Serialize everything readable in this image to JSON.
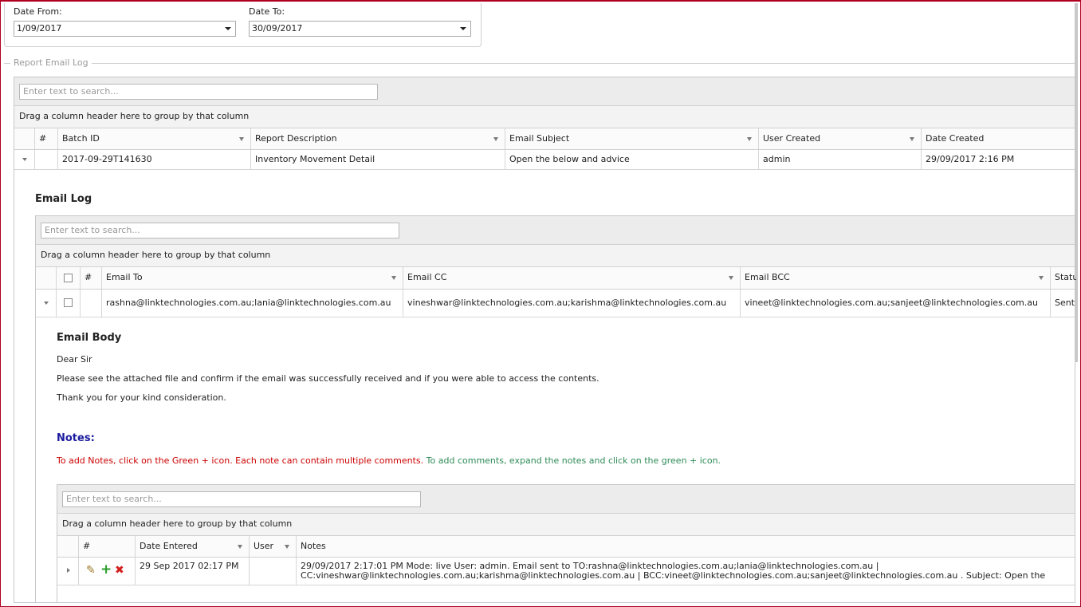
{
  "filters": {
    "date_from_label": "Date From:",
    "date_from_value": "1/09/2017",
    "date_to_label": "Date To:",
    "date_to_value": "30/09/2017"
  },
  "report_log": {
    "group_title": "Report Email Log",
    "search_placeholder": "Enter text to search...",
    "group_panel_text": "Drag a column header here to group by that column",
    "columns": {
      "row_number": "#",
      "batch_id": "Batch ID",
      "report_description": "Report Description",
      "email_subject": "Email Subject",
      "user_created": "User Created",
      "date_created": "Date Created"
    },
    "row": {
      "batch_id": "2017-09-29T141630",
      "report_description": "Inventory Movement Detail",
      "email_subject": "Open the below and advice",
      "user_created": "admin",
      "date_created": "29/09/2017 2:16 PM"
    }
  },
  "email_log": {
    "title": "Email Log",
    "search_placeholder": "Enter text to search...",
    "group_panel_text": "Drag a column header here to group by that column",
    "columns": {
      "row_number": "#",
      "email_to": "Email To",
      "email_cc": "Email CC",
      "email_bcc": "Email BCC",
      "status": "Statu"
    },
    "row": {
      "email_to": "rashna@linktechnologies.com.au;lania@linktechnologies.com.au",
      "email_cc": "vineshwar@linktechnologies.com.au;karishma@linktechnologies.com.au",
      "email_bcc": "vineet@linktechnologies.com.au;sanjeet@linktechnologies.com.au",
      "status": "Sent"
    }
  },
  "email_body": {
    "title": "Email Body",
    "greeting": "Dear Sir",
    "line1": "Please see the attached file and confirm if the email was successfully received and if you were able to access the contents.",
    "line2": "Thank you for your kind consideration."
  },
  "notes": {
    "title": "Notes:",
    "instruction_red": "To add Notes, click on the Green + icon. Each note can contain multiple comments.",
    "instruction_green": "To add comments, expand the notes and click on the green + icon.",
    "search_placeholder": "Enter text to search...",
    "group_panel_text": "Drag a column header here to group by that column",
    "columns": {
      "row_number": "#",
      "date_entered": "Date Entered",
      "user": "User",
      "notes": "Notes"
    },
    "row": {
      "date_entered": "29 Sep 2017 02:17 PM",
      "user": "",
      "notes_line1": "29/09/2017 2:17:01 PM Mode: live User: admin. Email sent to TO:rashna@linktechnologies.com.au;lania@linktechnologies.com.au |",
      "notes_line2": "CC:vineshwar@linktechnologies.com.au;karishma@linktechnologies.com.au | BCC:vineet@linktechnologies.com.au;sanjeet@linktechnologies.com.au . Subject: Open the"
    },
    "icons": {
      "edit": "pencil-icon",
      "add": "plus-icon",
      "delete": "x-icon"
    }
  }
}
